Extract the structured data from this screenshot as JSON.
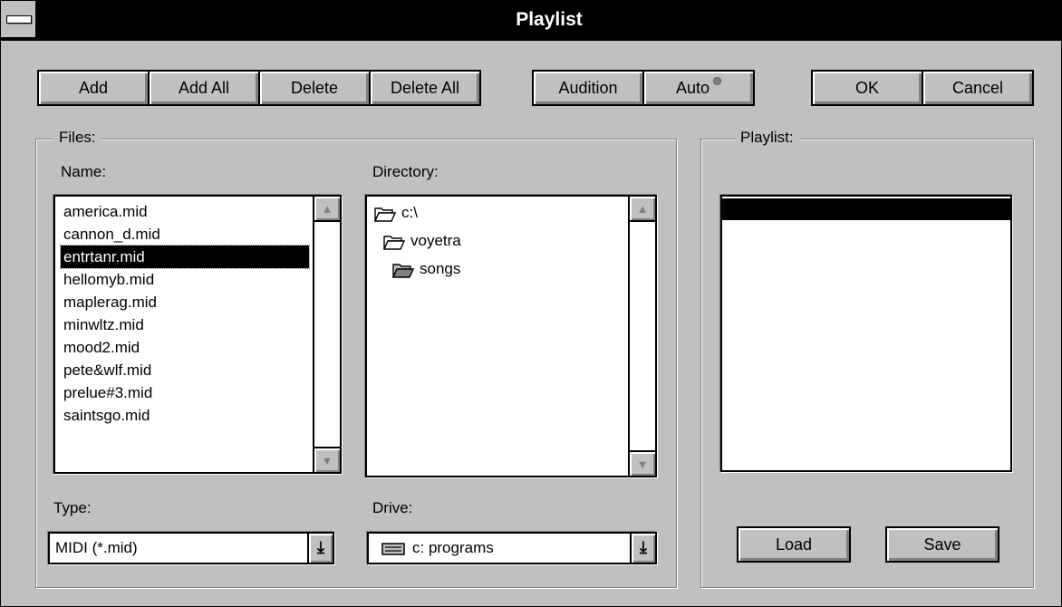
{
  "window": {
    "title": "Playlist"
  },
  "toolbar": {
    "add": "Add",
    "add_all": "Add All",
    "delete": "Delete",
    "delete_all": "Delete All",
    "audition": "Audition",
    "auto": "Auto",
    "ok": "OK",
    "cancel": "Cancel"
  },
  "files": {
    "group_label": "Files:",
    "name_label": "Name:",
    "name_items": [
      "america.mid",
      "cannon_d.mid",
      "entrtanr.mid",
      "hellomyb.mid",
      "maplerag.mid",
      "minwltz.mid",
      "mood2.mid",
      "pete&wlf.mid",
      "prelue#3.mid",
      "saintsgo.mid"
    ],
    "selected_item": "entrtanr.mid",
    "directory_label": "Directory:",
    "directory_items": [
      "c:\\",
      "voyetra",
      "songs"
    ],
    "type_label": "Type:",
    "type_value": "MIDI (*.mid)",
    "drive_label": "Drive:",
    "drive_value": "c: programs"
  },
  "playlist": {
    "group_label": "Playlist:",
    "load": "Load",
    "save": "Save"
  },
  "colors": {
    "title_bg": "#000000",
    "face": "#c0c0c0",
    "selection": "#000000"
  }
}
